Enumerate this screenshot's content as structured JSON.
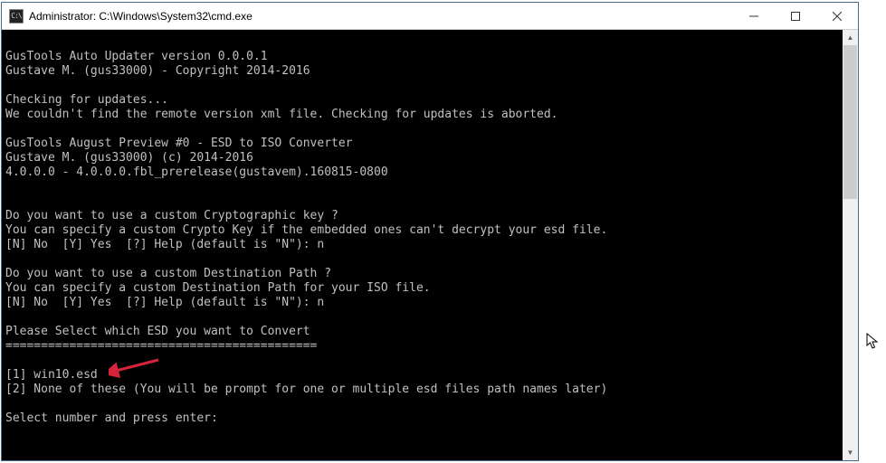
{
  "window": {
    "icon_label": "C:\\",
    "title": "Administrator: C:\\Windows\\System32\\cmd.exe"
  },
  "terminal": {
    "lines": [
      "",
      "GusTools Auto Updater version 0.0.0.1",
      "Gustave M. (gus33000) - Copyright 2014-2016",
      "",
      "Checking for updates...",
      "We couldn't find the remote version xml file. Checking for updates is aborted.",
      "",
      "GusTools August Preview #0 - ESD to ISO Converter",
      "Gustave M. (gus33000) (c) 2014-2016",
      "4.0.0.0 - 4.0.0.0.fbl_prerelease(gustavem).160815-0800",
      "",
      "",
      "Do you want to use a custom Cryptographic key ?",
      "You can specify a custom Crypto Key if the embedded ones can't decrypt your esd file.",
      "[N] No  [Y] Yes  [?] Help (default is \"N\"): n",
      "",
      "Do you want to use a custom Destination Path ?",
      "You can specify a custom Destination Path for your ISO file.",
      "[N] No  [Y] Yes  [?] Help (default is \"N\"): n",
      "",
      "Please Select which ESD you want to Convert",
      "============================================",
      "",
      "[1] win10.esd",
      "[2] None of these (You will be prompt for one or multiple esd files path names later)",
      "",
      "Select number and press enter:"
    ]
  },
  "colors": {
    "arrow": "#d6243a"
  }
}
